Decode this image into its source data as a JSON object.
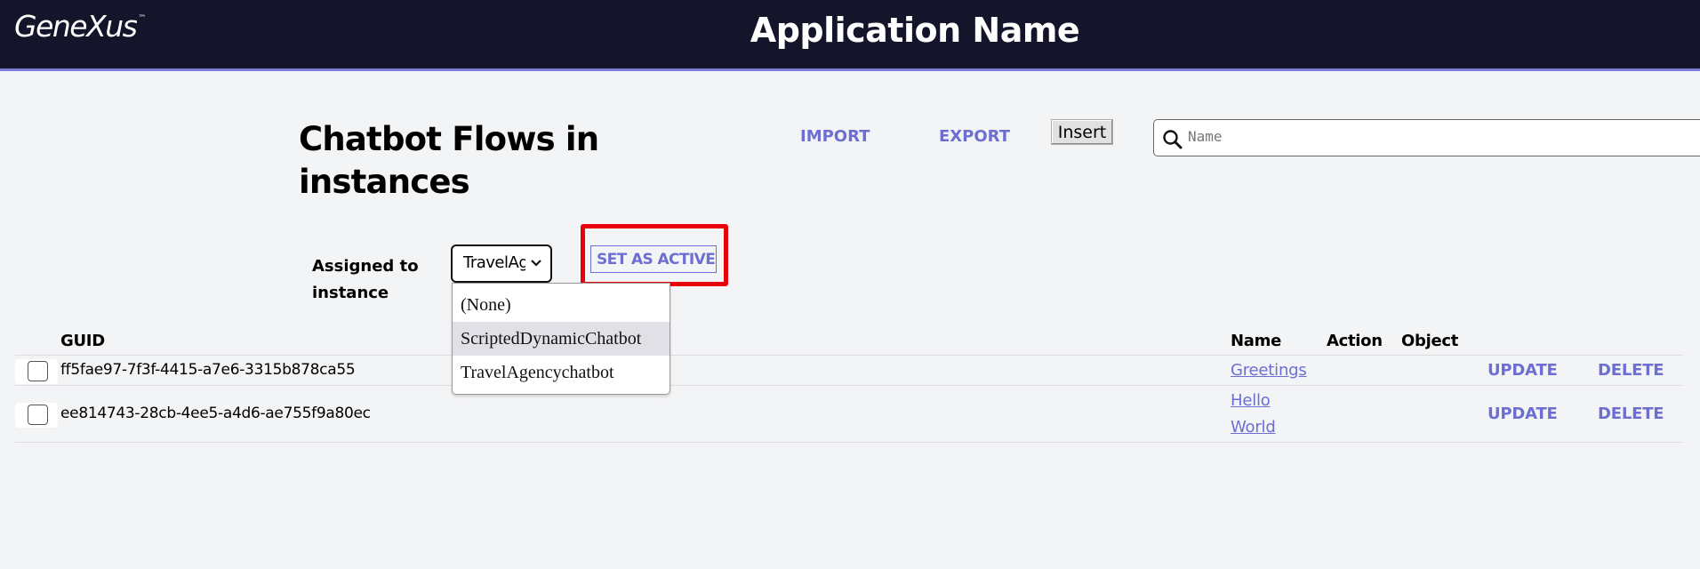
{
  "header": {
    "logo_text": "GeneXus",
    "logo_tm": "™",
    "app_title": "Application Name"
  },
  "page": {
    "title": "Chatbot Flows in instances"
  },
  "toolbar": {
    "import_label": "IMPORT",
    "export_label": "EXPORT",
    "insert_label": "Insert",
    "search_placeholder": "Name",
    "search_value": ""
  },
  "filter": {
    "label": "Assigned to instance",
    "selected_value": "TravelAgencychatbot",
    "set_active_label": "SET AS ACTIVE",
    "options": [
      "(None)",
      "ScriptedDynamicChatbot",
      "TravelAgencychatbot"
    ],
    "hovered_option": "ScriptedDynamicChatbot"
  },
  "table": {
    "columns": [
      "GUID",
      "Name",
      "Action",
      "Object"
    ],
    "rows": [
      {
        "guid": "ff5fae97-7f3f-4415-a7e6-3315b878ca55",
        "name": "Greetings",
        "action": "",
        "object": "",
        "checked": false,
        "update_label": "UPDATE",
        "delete_label": "DELETE"
      },
      {
        "guid": "ee814743-28cb-4ee5-a4d6-ae755f9a80ec",
        "name": "Hello World",
        "action": "",
        "object": "",
        "checked": false,
        "update_label": "UPDATE",
        "delete_label": "DELETE"
      }
    ]
  },
  "colors": {
    "header_bg": "#14142a",
    "accent": "#6c6fd1",
    "highlight": "#e8000b",
    "page_bg": "#f3f4f6"
  }
}
